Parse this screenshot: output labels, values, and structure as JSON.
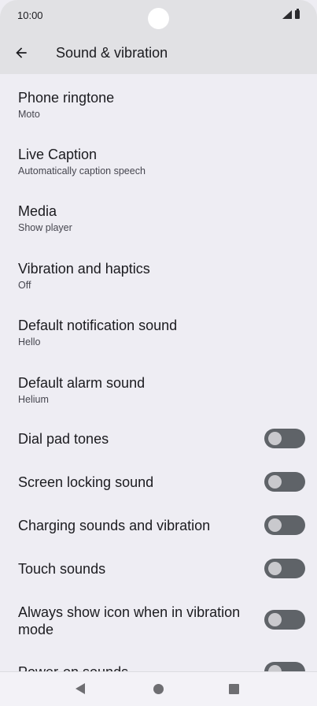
{
  "status": {
    "time": "10:00"
  },
  "header": {
    "title": "Sound & vibration",
    "back_icon": "arrow-back-icon"
  },
  "settings": {
    "phone_ringtone": {
      "title": "Phone ringtone",
      "subtitle": "Moto"
    },
    "live_caption": {
      "title": "Live Caption",
      "subtitle": "Automatically caption speech"
    },
    "media": {
      "title": "Media",
      "subtitle": "Show player"
    },
    "vibration_haptics": {
      "title": "Vibration and haptics",
      "subtitle": "Off"
    },
    "default_notification_sound": {
      "title": "Default notification sound",
      "subtitle": "Hello"
    },
    "default_alarm_sound": {
      "title": "Default alarm sound",
      "subtitle": "Helium"
    }
  },
  "toggles": {
    "dial_pad_tones": {
      "label": "Dial pad tones",
      "on": false
    },
    "screen_locking_sound": {
      "label": "Screen locking sound",
      "on": false
    },
    "charging_sounds": {
      "label": "Charging sounds and vibration",
      "on": false
    },
    "touch_sounds": {
      "label": "Touch sounds",
      "on": false
    },
    "vibration_mode_icon": {
      "label_line1": "Always show icon when in vibration",
      "label_line2": "mode",
      "on": false
    },
    "power_on_sounds": {
      "label": "Power-on sounds",
      "on": false
    }
  },
  "colors": {
    "background": "#eeedf3",
    "header_bg": "#e1e1e4",
    "toggle_off_track": "#5f6368",
    "toggle_off_knob": "#c9c9cd"
  }
}
